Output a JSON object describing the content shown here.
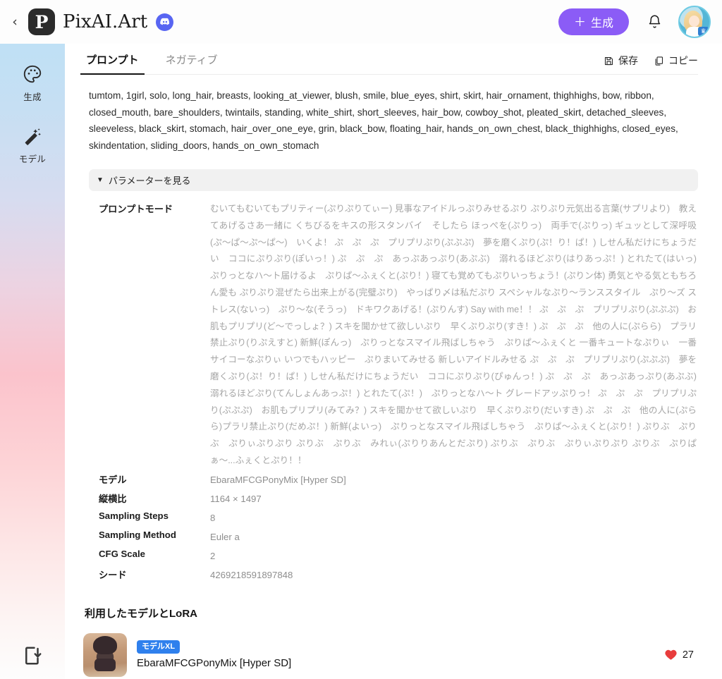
{
  "header": {
    "back_icon": "chevron-left-icon",
    "logo_mark": "P",
    "logo_text": "PixAI.Art",
    "discord_icon": "discord-icon",
    "generate_label": "生成",
    "generate_plus": "＋",
    "bell_icon": "bell-icon",
    "avatar_icon": "user-avatar",
    "avatar_crown": "♛",
    "accent_color": "#8b5cf6"
  },
  "sidebar": {
    "items": [
      {
        "icon": "palette-icon",
        "label": "生成"
      },
      {
        "icon": "magic-wand-icon",
        "label": "モデル"
      }
    ],
    "bottom_icon": "install-app-icon"
  },
  "tabs": [
    {
      "label": "プロンプト",
      "active": true
    },
    {
      "label": "ネガティブ",
      "active": false
    }
  ],
  "tab_actions": [
    {
      "icon": "save-icon",
      "label": "保存"
    },
    {
      "icon": "copy-icon",
      "label": "コピー"
    }
  ],
  "prompt": {
    "text": "tumtom, 1girl, solo, long_hair, breasts, looking_at_viewer, blush, smile, blue_eyes, shirt, skirt, hair_ornament, thighhighs, bow, ribbon, closed_mouth, bare_shoulders, twintails, standing, white_shirt, short_sleeves, hair_bow, cowboy_shot, pleated_skirt, detached_sleeves, sleeveless, black_skirt, stomach, hair_over_one_eye, grin, black_bow, floating_hair, hands_on_own_chest, black_thighhighs, closed_eyes, skindentation, sliding_doors, hands_on_own_stomach"
  },
  "params_toggle": {
    "caret": "▼",
    "label": "パラメーターを見る"
  },
  "params": [
    {
      "key": "プロンプトモード",
      "value": "むいてもむいてもプリティー(ぷりぷりてぃー) 見事なアイドルっぷりみせるぷり ぷりぷり元気出る言葉(サプリより)　教えてあげるさあ一緒に くちびるをキスの形スタンバイ　そしたら ほっぺを(ぷりっ)　両手で(ぷりっ) ギュッとして深呼吸(ぷ〜ぱ〜ぷ〜ぱ〜)　いくよ！ ぷ　ぷ　ぷ　プリプリぷり(ぷぷぷ)　夢を磨くぷり(ぷ！り！ぱ！) しせん私だけにちょうだい　ココにぷりぷり(ぽいっ！) ぷ　ぷ　ぷ　あっぷあっぷり(あぷぶ)　溺れるほどぷり(はりあっぷ！) とれたて(はいっ)　ぷりっとなハ〜ト届けるよ　ぷりぱ〜ふぇくと(ぷり！) 寝ても覚めてもぷりいっちょう！(ぷりン体) 勇気とやる気ともちろん愛も ぷりぷり混ぜたら出来上がる(完璧ぷり)　やっぱり〆は私だぷり スペシャルなぷり〜ランススタイル　ぷり〜ズ ストレス(ないっ)　ぷり〜な(そうっ)　ドキワクあげる！(ぷりんす) Say with me！！ ぷ　ぷ　ぷ　プリプリぷり(ぷぷぷ)　お肌もプリプリ(ど〜でっしょ？) スキを聞かせて欲しいぷり　早くぷりぷり(すき！) ぷ　ぷ　ぷ　他の人に(ぷらら)　プラリ禁止ぷり(りぷえすと) 新鮮(ぽんっ)　ぷりっとなスマイル飛ばしちゃう　ぷりぱ〜ふぇくと 一番キュートなぷりぃ　一番サイコーなぷりぃ いつでもハッピー　ぷりまいてみせる 新しいアイドルみせる ぷ　ぷ　ぷ　プリプリぷり(ぷぷぷ)　夢を磨くぷり(ぷ！り！ぱ！) しせん私だけにちょうだい　ココにぷりぷり(ぴゅんっ！) ぷ　ぷ　ぷ　あっぷあっぷり(あぷぶ)　溺れるほどぷり(てんしょんあっぷ！) とれたて(ぷ！)　ぷりっとなハ〜ト グレードアッぷりっ！ ぷ　ぷ　ぷ　プリプリぷり(ぷぷぷ)　お肌もプリプリ(みてみ？) スキを聞かせて欲しいぷり　早くぷりぷり(だいすき) ぷ　ぷ　ぷ　他の人に(ぷらら)プラリ禁止ぷり(だめぷ！) 新鮮(よいっ)　ぷりっとなスマイル飛ばしちゃう　ぷりぱ〜ふぇくと(ぷり！) ぷりぶ　ぷりぶ　ぷりぃぷりぷり ぷりぶ　ぷりぶ　みれぃ(ぷりりあんとだぷり) ぷりぶ　ぷりぶ　ぷりぃぷりぷり ぷりぶ　ぷりぱぁ〜...ふぇくとぷり！！",
      "long": true
    },
    {
      "key": "モデル",
      "value": "EbaraMFCGPonyMix [Hyper SD]"
    },
    {
      "key": "縦横比",
      "value": "1164 × 1497"
    },
    {
      "key": "Sampling Steps",
      "value": "8"
    },
    {
      "key": "Sampling Method",
      "value": "Euler a"
    },
    {
      "key": "CFG Scale",
      "value": "2"
    },
    {
      "key": "シード",
      "value": "4269218591897848"
    }
  ],
  "models_section": {
    "title": "利用したモデルとLoRA",
    "model": {
      "thumb_icon": "model-thumbnail",
      "badge": "モデルXL",
      "name": "EbaraMFCGPonyMix [Hyper SD]",
      "like_icon": "heart-icon",
      "like_count": "27",
      "like_color": "#e83c3c"
    }
  }
}
